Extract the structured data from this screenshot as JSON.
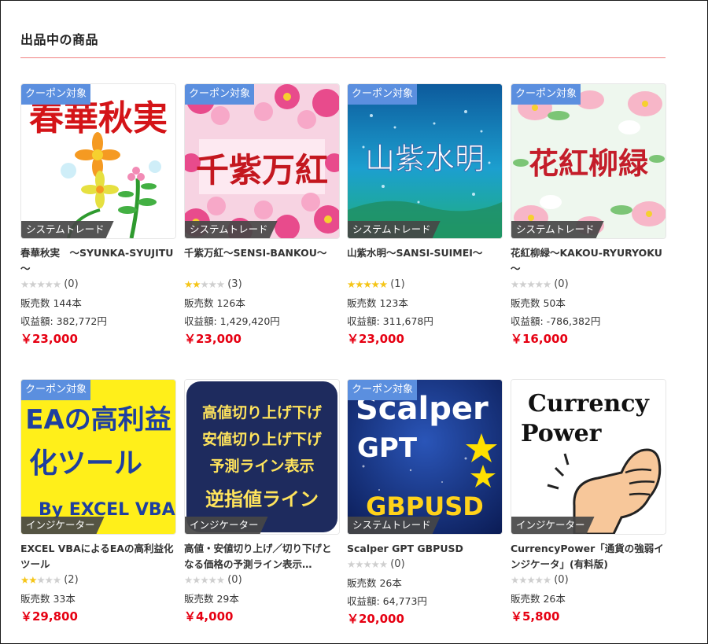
{
  "section": {
    "title": "出品中の商品"
  },
  "colors": {
    "accent_price": "#e60012",
    "coupon_badge": "#5b8fdf",
    "star_on": "#f5c518",
    "star_off": "#cfcfcf",
    "rule": "#f08080"
  },
  "products": [
    {
      "name": "春華秋実　～SYUNKA-SYUJITU～",
      "coupon": "クーポン対象",
      "category": "システムトレード",
      "rating": 0,
      "reviews": "(0)",
      "sales": "販売数 144本",
      "profit": "収益額: 382,772円",
      "price": "￥23,000",
      "thumb_text": "春華秋実",
      "icon": "flower-illustration"
    },
    {
      "name": "千紫万紅～SENSI-BANKOU～",
      "coupon": "クーポン対象",
      "category": "システムトレード",
      "rating": 2,
      "reviews": "(3)",
      "sales": "販売数 126本",
      "profit": "収益額: 1,429,420円",
      "price": "￥23,000",
      "thumb_text": "千紫万紅",
      "icon": "flower-frame"
    },
    {
      "name": "山紫水明～SANSI-SUIMEI～",
      "coupon": "クーポン対象",
      "category": "システムトレード",
      "rating": 5,
      "reviews": "(1)",
      "sales": "販売数 123本",
      "profit": "収益額: 311,678円",
      "price": "￥23,000",
      "thumb_text": "山紫水明",
      "icon": "night-sky"
    },
    {
      "name": "花紅柳緑～KAKOU-RYURYOKU～",
      "coupon": "クーポン対象",
      "category": "システムトレード",
      "rating": 0,
      "reviews": "(0)",
      "sales": "販売数 50本",
      "profit": "収益額: -786,382円",
      "price": "￥16,000",
      "thumb_text": "花紅柳緑",
      "icon": "dogwood-flowers"
    },
    {
      "name": "EXCEL VBAによるEAの高利益化ツール",
      "coupon": "クーポン対象",
      "category": "インジケーター",
      "rating": 2,
      "reviews": "(2)",
      "sales": "販売数 33本",
      "profit": "",
      "price": "￥29,800",
      "thumb_lines": [
        "EAの高利益",
        "化ツール",
        "By EXCEL VBA"
      ],
      "icon": "text-banner"
    },
    {
      "name": "高値・安値切り上げ／切り下げとなる価格の予測ライン表示…",
      "coupon": "",
      "category": "インジケーター",
      "rating": 0,
      "reviews": "(0)",
      "sales": "販売数 29本",
      "profit": "",
      "price": "￥4,000",
      "thumb_lines": [
        "高値切り上げ下げ",
        "安値切り上げ下げ",
        "予測ライン表示",
        "逆指値ライン"
      ],
      "icon": "text-banner"
    },
    {
      "name": "Scalper GPT GBPUSD",
      "coupon": "クーポン対象",
      "category": "システムトレード",
      "rating": 0,
      "reviews": "(0)",
      "sales": "販売数 26本",
      "profit": "収益額: 64,773円",
      "price": "￥20,000",
      "thumb_lines": [
        "Scalper",
        "GPT",
        "GBPUSD"
      ],
      "icon": "star-icon"
    },
    {
      "name": "CurrencyPower「通貨の強弱インジケータ」(有料版)",
      "coupon": "",
      "category": "インジケーター",
      "rating": 0,
      "reviews": "(0)",
      "sales": "販売数 26本",
      "profit": "",
      "price": "￥5,800",
      "thumb_lines": [
        "Currency",
        "Power"
      ],
      "icon": "fist-icon"
    }
  ]
}
